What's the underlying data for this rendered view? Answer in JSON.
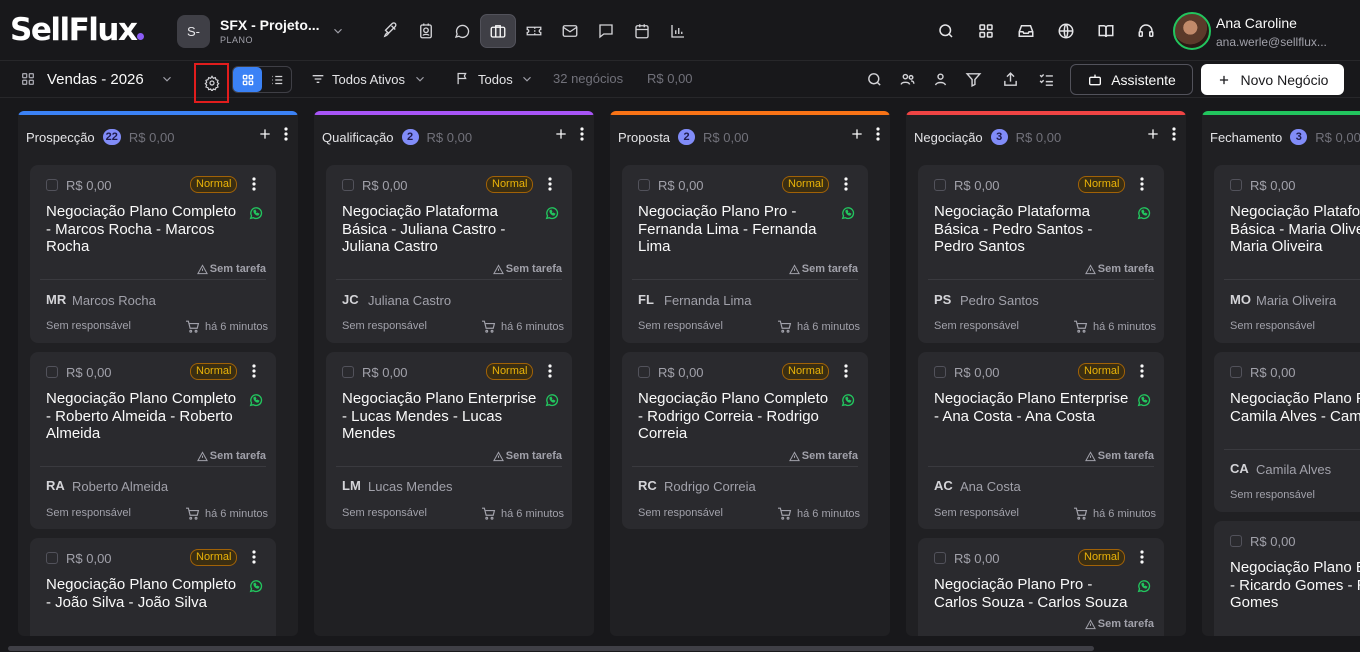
{
  "header": {
    "logo": "SellFlux",
    "project": {
      "avatar": "S-",
      "name": "SFX - Projeto...",
      "plan": "PLANO"
    },
    "nav_icons": [
      "rocket-icon",
      "contact-card-icon",
      "chat-icon",
      "briefcase-icon",
      "ticket-icon",
      "mail-icon",
      "message-square-icon",
      "calendar-icon",
      "bar-chart-icon"
    ],
    "active_nav": "briefcase-icon",
    "right_icons": [
      "search-icon",
      "apps-grid-icon",
      "inbox-icon",
      "globe-icon",
      "book-icon",
      "headset-icon"
    ],
    "user": {
      "name": "Ana Caroline",
      "email": "ana.werle@sellflux..."
    }
  },
  "toolbar": {
    "pipeline": "Vendas - 2026",
    "status_filter": "Todos Ativos",
    "owner_filter": "Todos",
    "summary_count": "32 negócios",
    "summary_value": "R$ 0,00",
    "assistant_label": "Assistente",
    "new_deal_label": "Novo Negócio"
  },
  "colors": {
    "prospeccao": "#3b82f6",
    "qualificacao": "#a855f7",
    "proposta": "#f97316",
    "negociacao": "#ef4444",
    "fechamento": "#22c55e",
    "accent": "#3b82f6",
    "badge": "#eab308",
    "whatsapp": "#22c55e"
  },
  "columns": [
    {
      "title": "Prospecção",
      "count": "22",
      "value": "R$ 0,00",
      "cards": [
        {
          "value": "R$ 0,00",
          "badge": "Normal",
          "title": "Negociação Plano Completo - Marcos Rocha - Marcos Rocha",
          "task": "Sem tarefa",
          "initials": "MR",
          "contact": "Marcos Rocha",
          "responsible": "Sem responsável",
          "time": "há 6 minutos"
        },
        {
          "value": "R$ 0,00",
          "badge": "Normal",
          "title": "Negociação Plano Completo - Roberto Almeida - Roberto Almeida",
          "task": "Sem tarefa",
          "initials": "RA",
          "contact": "Roberto Almeida",
          "responsible": "Sem responsável",
          "time": "há 6 minutos"
        },
        {
          "value": "R$ 0,00",
          "badge": "Normal",
          "title": "Negociação Plano Completo - João Silva - João Silva"
        }
      ]
    },
    {
      "title": "Qualificação",
      "count": "2",
      "value": "R$ 0,00",
      "cards": [
        {
          "value": "R$ 0,00",
          "badge": "Normal",
          "title": "Negociação Plataforma Básica - Juliana Castro - Juliana Castro",
          "task": "Sem tarefa",
          "initials": "JC",
          "contact": "Juliana Castro",
          "responsible": "Sem responsável",
          "time": "há 6 minutos"
        },
        {
          "value": "R$ 0,00",
          "badge": "Normal",
          "title": "Negociação Plano Enterprise - Lucas Mendes - Lucas Mendes",
          "task": "Sem tarefa",
          "initials": "LM",
          "contact": "Lucas Mendes",
          "responsible": "Sem responsável",
          "time": "há 6 minutos"
        }
      ]
    },
    {
      "title": "Proposta",
      "count": "2",
      "value": "R$ 0,00",
      "cards": [
        {
          "value": "R$ 0,00",
          "badge": "Normal",
          "title": "Negociação Plano Pro - Fernanda Lima - Fernanda Lima",
          "task": "Sem tarefa",
          "initials": "FL",
          "contact": "Fernanda Lima",
          "responsible": "Sem responsável",
          "time": "há 6 minutos"
        },
        {
          "value": "R$ 0,00",
          "badge": "Normal",
          "title": "Negociação Plano Completo - Rodrigo Correia - Rodrigo Correia",
          "task": "Sem tarefa",
          "initials": "RC",
          "contact": "Rodrigo Correia",
          "responsible": "Sem responsável",
          "time": "há 6 minutos"
        }
      ]
    },
    {
      "title": "Negociação",
      "count": "3",
      "value": "R$ 0,00",
      "cards": [
        {
          "value": "R$ 0,00",
          "badge": "Normal",
          "title": "Negociação Plataforma Básica - Pedro Santos - Pedro Santos",
          "task": "Sem tarefa",
          "initials": "PS",
          "contact": "Pedro Santos",
          "responsible": "Sem responsável",
          "time": "há 6 minutos"
        },
        {
          "value": "R$ 0,00",
          "badge": "Normal",
          "title": "Negociação Plano Enterprise - Ana Costa - Ana Costa",
          "task": "Sem tarefa",
          "initials": "AC",
          "contact": "Ana Costa",
          "responsible": "Sem responsável",
          "time": "há 6 minutos"
        },
        {
          "value": "R$ 0,00",
          "badge": "Normal",
          "title": "Negociação Plano Pro - Carlos Souza - Carlos Souza",
          "task": "Sem tarefa"
        }
      ]
    },
    {
      "title": "Fechamento",
      "count": "3",
      "value": "R$ 0,00",
      "cards": [
        {
          "value": "R$ 0,00",
          "title": "Negociação Plataforma Básica - Maria Oliveira - Maria Oliveira",
          "initials": "MO",
          "contact": "Maria Oliveira",
          "responsible": "Sem responsável"
        },
        {
          "value": "R$ 0,00",
          "title": "Negociação Plano Pro - Camila Alves - Camila Alves",
          "initials": "CA",
          "contact": "Camila Alves",
          "responsible": "Sem responsável"
        },
        {
          "value": "R$ 0,00",
          "title": "Negociação Plano Enterprise - Ricardo Gomes - Ricardo Gomes"
        }
      ]
    }
  ]
}
